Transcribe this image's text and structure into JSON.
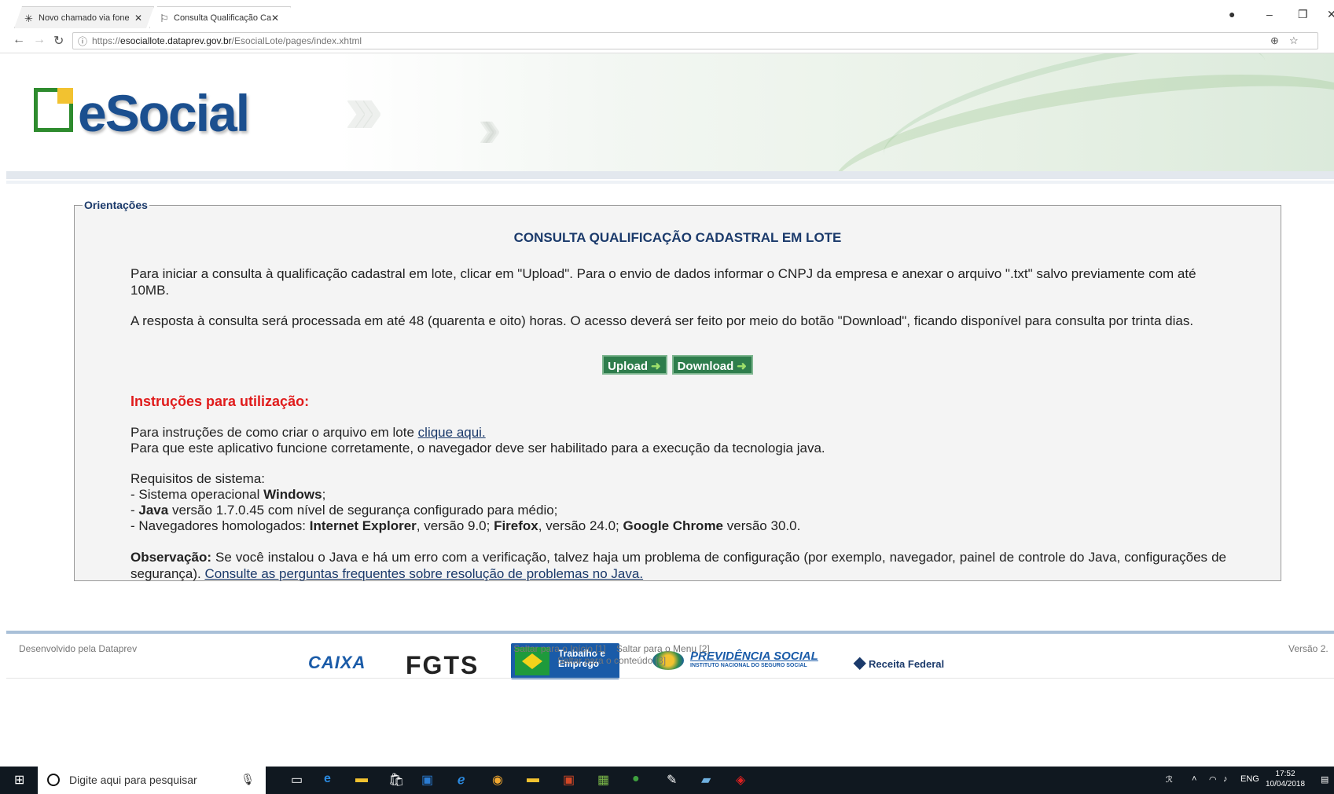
{
  "browser": {
    "tabs": [
      {
        "title": "Novo chamado via fone",
        "active": false
      },
      {
        "title": "Consulta Qualificação Ca",
        "active": true
      }
    ],
    "url_prefix": "https://",
    "url_host": "esociallote.dataprev.gov.br",
    "url_path": "/EsocialLote/pages/index.xhtml"
  },
  "header": {
    "logo_text": "eSocial"
  },
  "orientacoes": {
    "legend": "Orientações",
    "title": "CONSULTA QUALIFICAÇÃO CADASTRAL EM LOTE",
    "p1": "Para iniciar a consulta à qualificação cadastral em lote, clicar em \"Upload\". Para o envio de dados informar o CNPJ da empresa e anexar o arquivo \".txt\" salvo previamente com até 10MB.",
    "p2": "A resposta à consulta será processada em até 48 (quarenta e oito) horas. O acesso deverá ser feito por meio do botão \"Download\", ficando disponível para consulta por trinta dias.",
    "upload_label": "Upload",
    "download_label": "Download",
    "instructions_title": "Instruções para utilização:",
    "instr_line1_text": "Para instruções de como criar o arquivo em lote ",
    "instr_line1_link": "clique aqui. ",
    "instr_line2": "Para que este aplicativo funcione corretamente, o navegador deve ser habilitado para a execução da tecnologia java.",
    "req_title": "Requisitos de sistema:",
    "req1_pre": "- Sistema operacional ",
    "req1_bold": "Windows",
    "req1_post": ";",
    "req2_pre": "- ",
    "req2_bold": "Java",
    "req2_post": " versão 1.7.0.45 com nível de segurança configurado para médio;",
    "req3_pre": "- Navegadores homologados: ",
    "req3_b1": "Internet Explorer",
    "req3_t1": ", versão 9.0; ",
    "req3_b2": "Firefox",
    "req3_t2": ", versão 24.0; ",
    "req3_b3": "Google Chrome",
    "req3_t3": " versão 30.0.",
    "obs_bold": "Observação:",
    "obs_text": " Se você instalou o Java e há um erro com a verificação, talvez haja um problema de configuração (por exemplo, navegador, painel de controle do Java, configurações de segurança). ",
    "obs_link": "Consulte as perguntas frequentes sobre resolução de problemas no Java."
  },
  "footer": {
    "logos": {
      "caixa": "CAIXA",
      "fgts": "FGTS",
      "mte_line1": "Trabalho e",
      "mte_line2": "Emprego",
      "previdencia": "PREVIDÊNCIA SOCIAL",
      "previdencia_sub": "INSTITUTO NACIONAL DO SEGURO SOCIAL",
      "receita": "Receita Federal"
    },
    "developer": "Desenvolvido pela Dataprev",
    "skip_inicio": "Saltar para o Início [1]",
    "skip_menu": "Saltar para o Menu [2]",
    "skip_conteudo": "Saltar para o conteúdo [3]",
    "version": "Versão 2."
  },
  "taskbar": {
    "search_placeholder": "Digite aqui para pesquisar",
    "lang": "ENG",
    "time": "17:52",
    "date": "10/04/2018"
  }
}
